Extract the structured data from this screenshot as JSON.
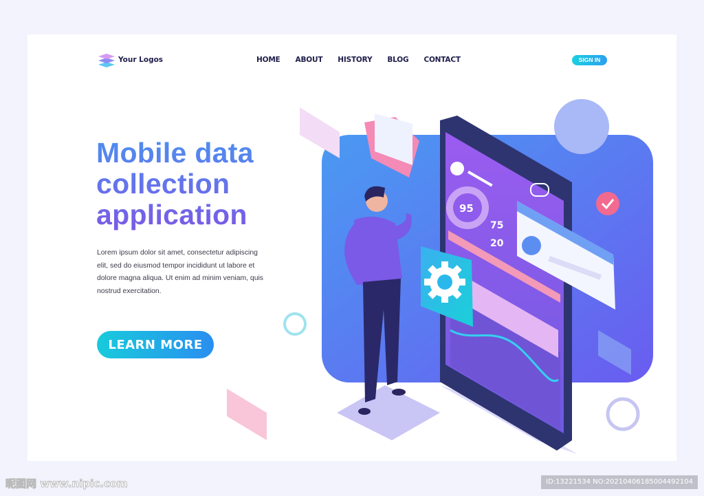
{
  "header": {
    "logo_text": "Your Logos",
    "nav": [
      "HOME",
      "ABOUT",
      "HISTORY",
      "BLOG",
      "CONTACT"
    ],
    "signin_label": "SIGN IN"
  },
  "hero": {
    "title_lines": [
      "Mobile data",
      "collection",
      "application"
    ],
    "description": "Lorem ipsum dolor sit amet, consectetur adipiscing elit, sed do eiusmod tempor incididunt ut labore et dolore magna aliqua. Ut enim ad minim veniam, quis nostrud exercitation.",
    "button_label": "LEARN MORE"
  },
  "illustration": {
    "stats": [
      "95",
      "75",
      "20"
    ],
    "icons": [
      "gear-icon",
      "check-icon",
      "folder-icon",
      "chat-bubble-icon"
    ]
  },
  "watermark": {
    "site": "昵图网 www.nipic.com",
    "id_text": "ID:13221534 NO:20210406185004492104"
  },
  "colors": {
    "accent": "#1ccfe0",
    "title_top": "#4d8ff0",
    "title_bottom": "#7a5ae6",
    "panel": "#5a72f0"
  }
}
